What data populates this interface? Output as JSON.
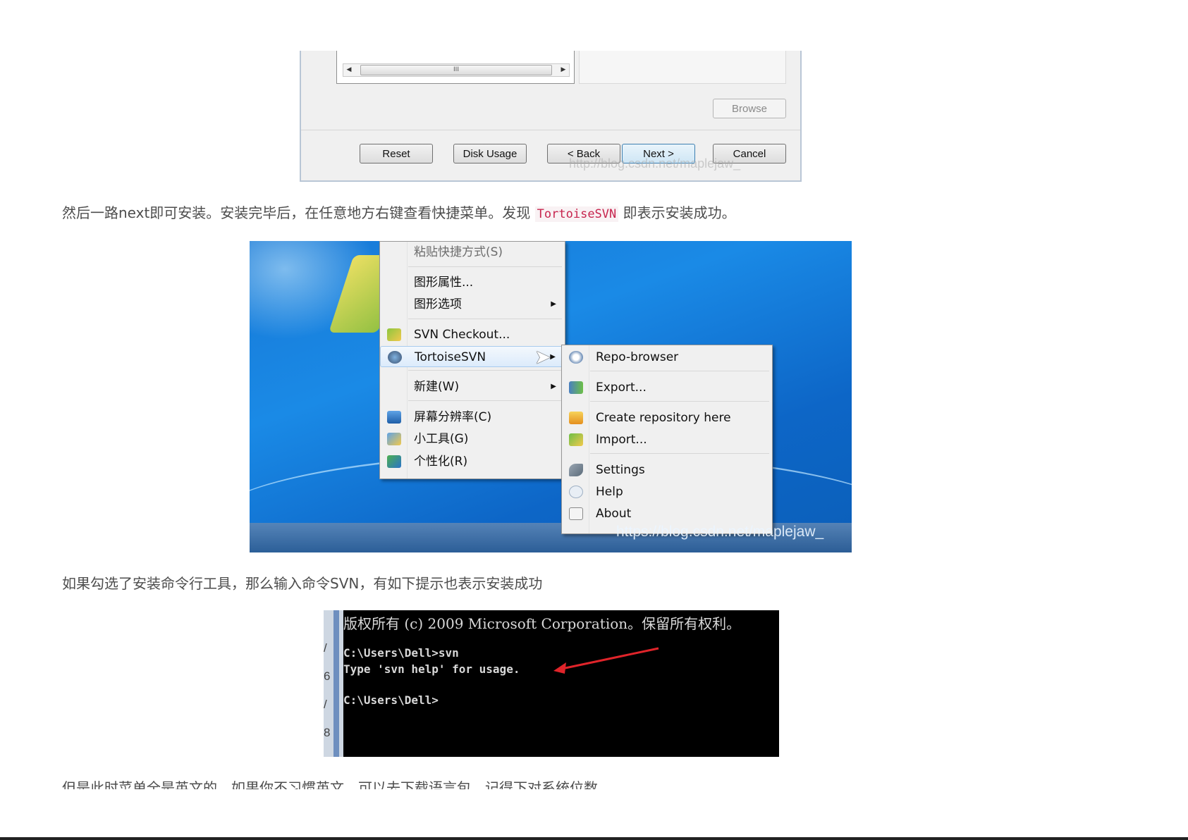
{
  "installer": {
    "scroll_thumb_grip": "III",
    "buttons": {
      "browse": "Browse",
      "reset": "Reset",
      "disk_usage": "Disk Usage",
      "back": "< Back",
      "next": "Next >",
      "cancel": "Cancel"
    },
    "watermark": "http://blog.csdn.net/maplejaw_"
  },
  "paragraph1": {
    "before": "然后一路next即可安装。安装完毕后，在任意地方右键查看快捷菜单。发现 ",
    "code": "TortoiseSVN",
    "after": " 即表示安装成功。"
  },
  "context_menu": {
    "items": [
      {
        "label": "粘贴快捷方式(S)",
        "icon": "none"
      },
      {
        "label": "图形属性...",
        "icon": "none"
      },
      {
        "label": "图形选项",
        "icon": "none",
        "submenu": true
      },
      {
        "label": "SVN Checkout...",
        "icon": "svn-checkout-icon"
      },
      {
        "label": "TortoiseSVN",
        "icon": "tortoisesvn-icon",
        "submenu": true
      },
      {
        "label": "新建(W)",
        "icon": "none",
        "submenu": true
      },
      {
        "label": "屏幕分辨率(C)",
        "icon": "screen-resolution-icon"
      },
      {
        "label": "小工具(G)",
        "icon": "gadgets-icon"
      },
      {
        "label": "个性化(R)",
        "icon": "personalize-icon"
      }
    ],
    "submenu_arrow": "▶"
  },
  "tortoise_submenu": {
    "items": [
      {
        "label": "Repo-browser",
        "icon": "repo-browser-icon"
      },
      {
        "label": "Export...",
        "icon": "export-icon"
      },
      {
        "label": "Create repository here",
        "icon": "create-repository-icon"
      },
      {
        "label": "Import...",
        "icon": "import-icon"
      },
      {
        "label": "Settings",
        "icon": "settings-icon"
      },
      {
        "label": "Help",
        "icon": "help-icon"
      },
      {
        "label": "About",
        "icon": "about-icon"
      }
    ]
  },
  "desktop_watermark": "https://blog.csdn.net/maplejaw_",
  "paragraph2": "如果勾选了安装命令行工具，那么输入命令SVN，有如下提示也表示安装成功",
  "console": {
    "line1": "版权所有 (c) 2009 Microsoft Corporation。保留所有权利。",
    "line2": "C:\\Users\\Dell>svn",
    "line3": "Type 'svn help' for usage.",
    "line4": "C:\\Users\\Dell>",
    "side_chars": [
      "/",
      "6",
      "/",
      "8"
    ],
    "arrow_color": "#e0242a"
  },
  "paragraph3_cut": "但是此时菜单全是英文的，如果你不习惯英文，可以去下载语言包，记得下对系统位数"
}
